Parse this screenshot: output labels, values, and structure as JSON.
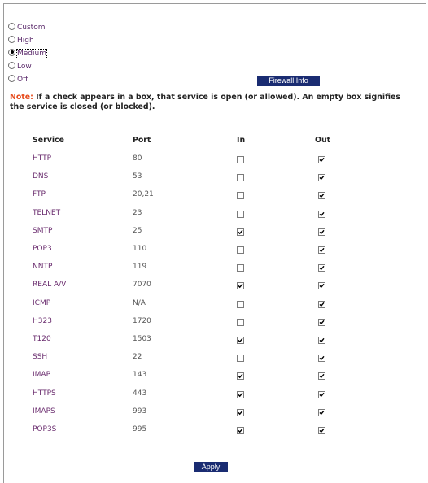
{
  "security_levels": [
    {
      "label": "Custom",
      "selected": false
    },
    {
      "label": "High",
      "selected": false
    },
    {
      "label": "Medium",
      "selected": true
    },
    {
      "label": "Low",
      "selected": false
    },
    {
      "label": "Off",
      "selected": false
    }
  ],
  "firewall_info_button": "Firewall Info",
  "note": {
    "label": "Note:",
    "text": " If a check appears in a box, that service is open (or allowed). An empty box signifies the service is closed (or blocked)."
  },
  "table": {
    "headers": {
      "service": "Service",
      "port": "Port",
      "in": "In",
      "out": "Out"
    },
    "rows": [
      {
        "service": "HTTP",
        "port": "80",
        "in": false,
        "out": true
      },
      {
        "service": "DNS",
        "port": "53",
        "in": false,
        "out": true
      },
      {
        "service": "FTP",
        "port": "20,21",
        "in": false,
        "out": true
      },
      {
        "service": "TELNET",
        "port": "23",
        "in": false,
        "out": true
      },
      {
        "service": "SMTP",
        "port": "25",
        "in": true,
        "out": true
      },
      {
        "service": "POP3",
        "port": "110",
        "in": false,
        "out": true
      },
      {
        "service": "NNTP",
        "port": "119",
        "in": false,
        "out": true
      },
      {
        "service": "REAL A/V",
        "port": "7070",
        "in": true,
        "out": true
      },
      {
        "service": "ICMP",
        "port": "N/A",
        "in": false,
        "out": true
      },
      {
        "service": "H323",
        "port": "1720",
        "in": false,
        "out": true
      },
      {
        "service": "T120",
        "port": "1503",
        "in": true,
        "out": true
      },
      {
        "service": "SSH",
        "port": "22",
        "in": false,
        "out": true
      },
      {
        "service": "IMAP",
        "port": "143",
        "in": true,
        "out": true
      },
      {
        "service": "HTTPS",
        "port": "443",
        "in": true,
        "out": true
      },
      {
        "service": "IMAPS",
        "port": "993",
        "in": true,
        "out": true
      },
      {
        "service": "POP3S",
        "port": "995",
        "in": true,
        "out": true
      }
    ]
  },
  "apply_button": "Apply"
}
